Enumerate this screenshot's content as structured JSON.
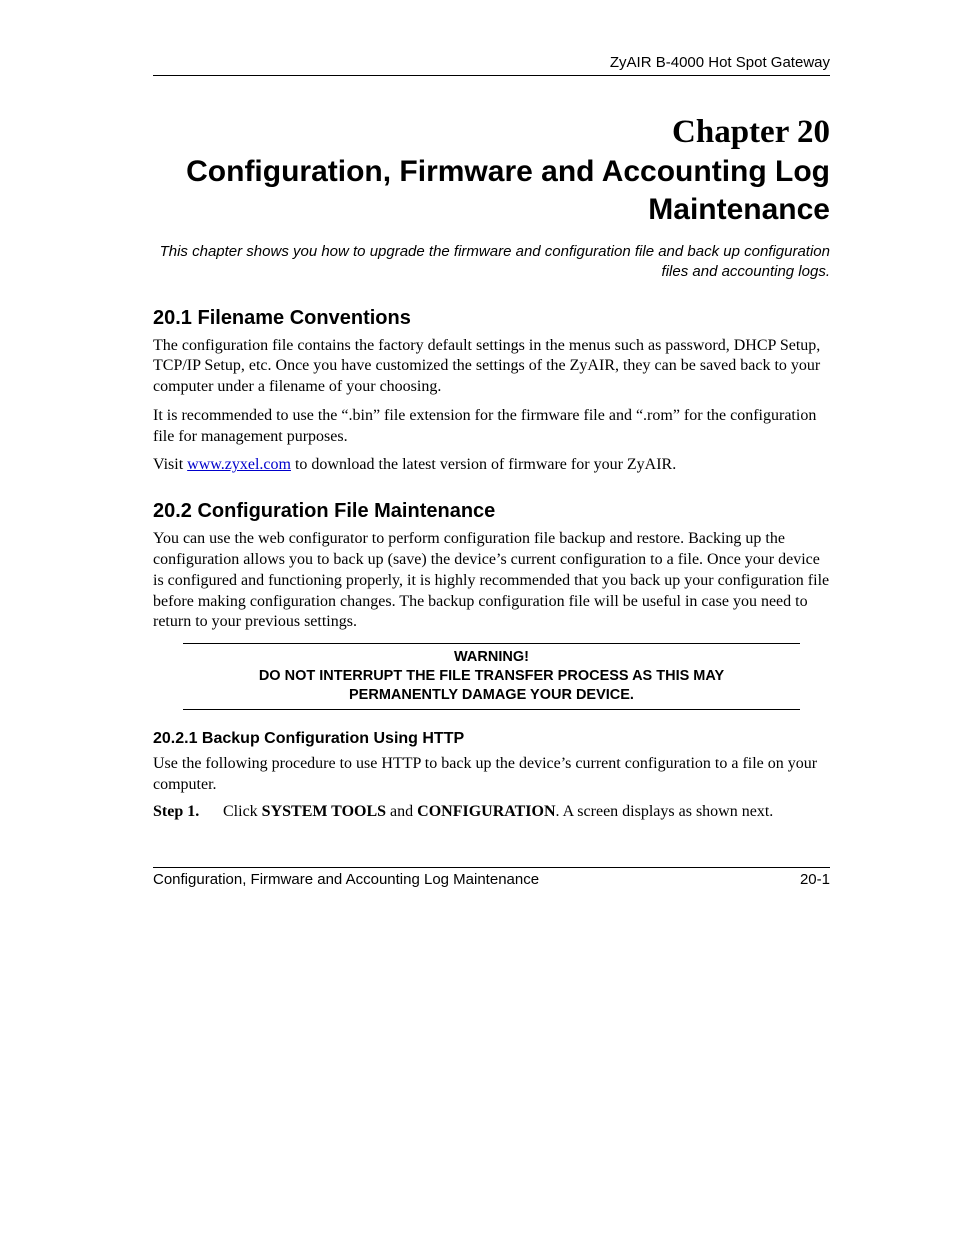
{
  "header": {
    "product": "ZyAIR B-4000 Hot Spot Gateway"
  },
  "chapter": {
    "number": "Chapter 20",
    "title": "Configuration, Firmware and Accounting Log Maintenance",
    "intro": "This chapter shows you how to upgrade the firmware and configuration file and back up configuration files and accounting logs."
  },
  "s1": {
    "heading": "20.1  Filename Conventions",
    "p1": "The configuration file contains the factory default settings in the menus such as password, DHCP Setup, TCP/IP Setup, etc. Once you have customized the settings of the ZyAIR, they can be saved back to your computer under a filename of your choosing.",
    "p2": "It is recommended to use the “.bin” file extension for the firmware file and “.rom” for the configuration file for management purposes.",
    "visit_pre": "Visit ",
    "link_text": "www.zyxel.com",
    "visit_post": " to download the latest version of firmware for your ZyAIR."
  },
  "s2": {
    "heading": "20.2  Configuration File Maintenance",
    "p1": "You can use the web configurator to perform configuration file backup and restore. Backing up the configuration allows you to back up (save) the device’s current configuration to a file. Once your device is configured and functioning properly, it is highly recommended that you back up your configuration file before making configuration changes. The backup configuration file will be useful in case you need to return to your previous settings."
  },
  "warning": {
    "title": "WARNING!",
    "line1": "DO NOT INTERRUPT THE FILE TRANSFER PROCESS AS THIS MAY",
    "line2": "PERMANENTLY DAMAGE YOUR DEVICE."
  },
  "s21": {
    "heading": "20.2.1 Backup Configuration Using HTTP",
    "p1": "Use the following procedure to use HTTP to back up the device’s current configuration to a file on your computer.",
    "step1_label": "Step 1.",
    "step1_pre": "Click ",
    "step1_b1": "SYSTEM TOOLS",
    "step1_mid": " and ",
    "step1_b2": "CONFIGURATION",
    "step1_post": ". A screen displays as shown next."
  },
  "footer": {
    "left": "Configuration, Firmware and Accounting Log Maintenance",
    "right": "20-1"
  }
}
